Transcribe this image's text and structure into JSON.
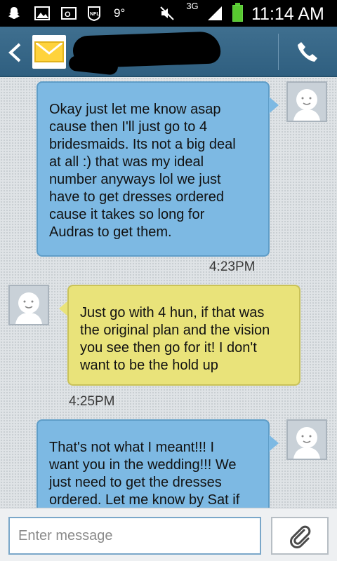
{
  "status_bar": {
    "temperature": "9°",
    "network": "3G",
    "time": "11:14 AM",
    "icons": [
      "snapchat-icon",
      "gallery-icon",
      "outlook-icon",
      "nfl-icon",
      "mute-icon",
      "signal-icon",
      "battery-icon"
    ]
  },
  "action_bar": {
    "back_icon": "chevron-left-icon",
    "contact_icon": "envelope-icon",
    "call_icon": "phone-icon"
  },
  "messages": [
    {
      "direction": "incoming",
      "text": "Okay just let me know asap cause then I'll just go to 4 bridesmaids. Its not a big deal at all :) that was my ideal number anyways lol we just have to get dresses ordered cause it takes so long for Audras to get them.",
      "lines": [
        "Okay just let me know asap",
        "cause then I'll just go to 4",
        "bridesmaids. Its not a big deal",
        "at all :) that was my ideal",
        "number anyways lol we just",
        "have to get dresses ordered",
        "cause it takes so long for",
        "Audras to get them."
      ],
      "time": "4:23PM"
    },
    {
      "direction": "outgoing",
      "text": "Just go with 4 hun, if that was the original plan and the vision you see then go for it! I don't want to be the hold up",
      "lines": [
        "Just go with 4 hun, if that was",
        "the original plan and the vision",
        "you see then go for it! I don't",
        "want to be the hold up"
      ],
      "time": "4:25PM"
    },
    {
      "direction": "incoming",
      "text": "That's not what I meant!!! I want you in the wedding!!! We just need to get the dresses ordered. Let me know by Sat if",
      "lines": [
        "That's not what I meant!!! I",
        "want you in the wedding!!! We",
        "just need to get the dresses",
        "ordered. Let me know by Sat if"
      ]
    }
  ],
  "composer": {
    "placeholder": "Enter message",
    "attach_icon": "paperclip-icon"
  },
  "colors": {
    "incoming_bubble": "#7db9e3",
    "outgoing_bubble": "#e9e37a",
    "action_bar": "#36678a"
  }
}
